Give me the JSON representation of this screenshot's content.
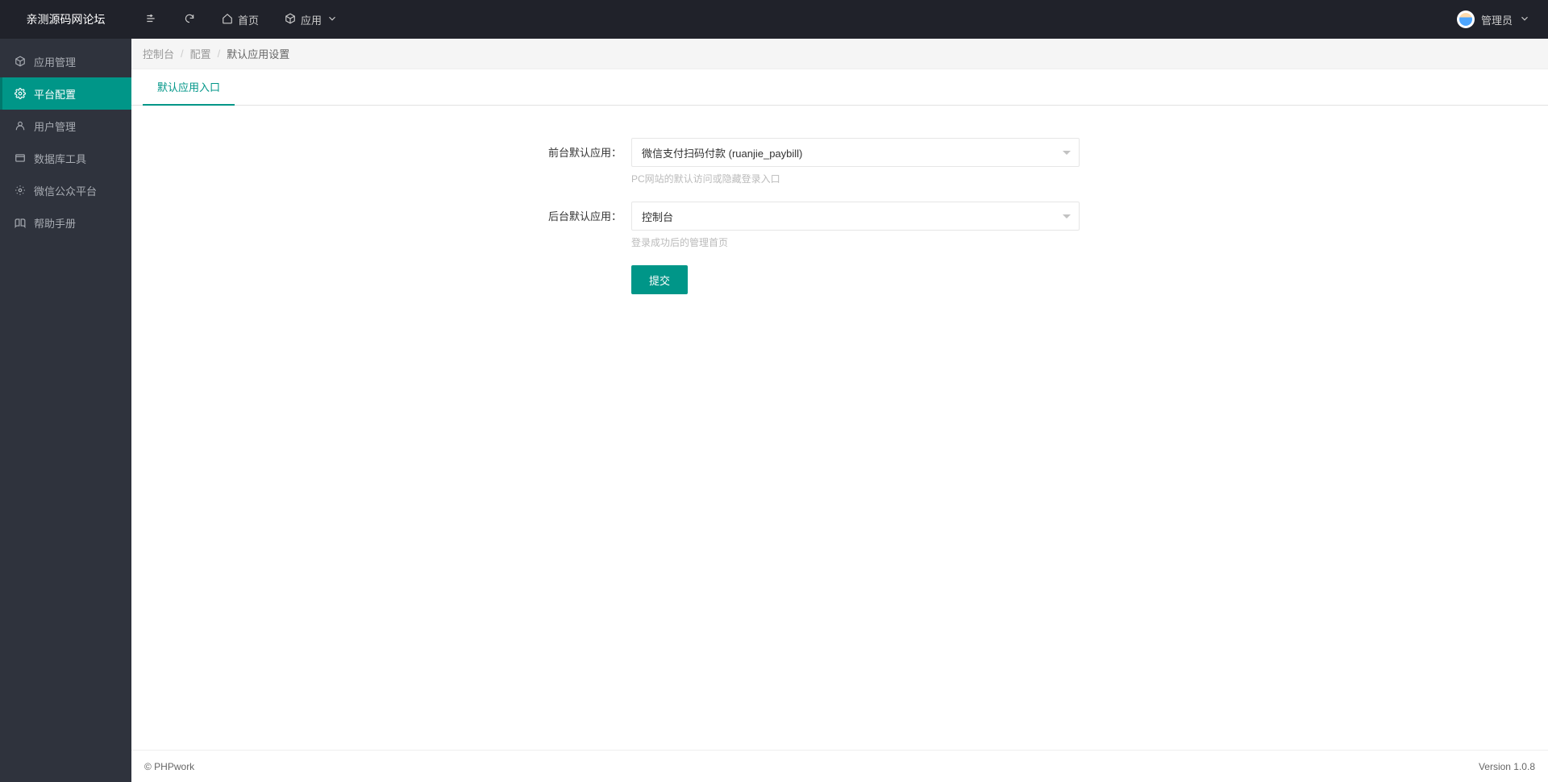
{
  "brand": "亲测源码网论坛",
  "header": {
    "home": "首页",
    "apps": "应用",
    "user": "管理员"
  },
  "sidebar": {
    "items": [
      {
        "label": "应用管理"
      },
      {
        "label": "平台配置"
      },
      {
        "label": "用户管理"
      },
      {
        "label": "数据库工具"
      },
      {
        "label": "微信公众平台"
      },
      {
        "label": "帮助手册"
      }
    ]
  },
  "breadcrumb": {
    "a": "控制台",
    "b": "配置",
    "c": "默认应用设置"
  },
  "tab": "默认应用入口",
  "form": {
    "front_label": "前台默认应用：",
    "front_value": "微信支付扫码付款   (ruanjie_paybill)",
    "front_hint": "PC网站的默认访问或隐藏登录入口",
    "back_label": "后台默认应用：",
    "back_value": "控制台",
    "back_hint": "登录成功后的管理首页",
    "submit": "提交"
  },
  "footer": {
    "left": "© PHPwork",
    "right": "Version 1.0.8"
  }
}
